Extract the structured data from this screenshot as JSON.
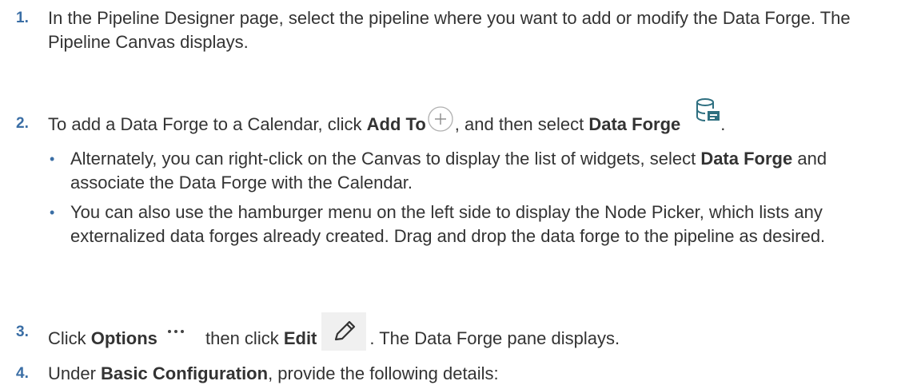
{
  "steps": [
    {
      "number": "1.",
      "text": "In the Pipeline Designer page, select the pipeline where you want to add or modify the Data Forge. The Pipeline Canvas displays."
    },
    {
      "number": "2.",
      "pre": "To add a Data Forge to a Calendar, click ",
      "bold1": "Add To",
      "mid": ", and then select ",
      "bold2": "Data Forge",
      "post": ".",
      "icons": [
        "add-to-plus-icon",
        "data-forge-database-icon"
      ],
      "bullets": [
        {
          "pre": "Alternately, you can right-click on the Canvas to display the list of widgets, select ",
          "bold": "Data Forge",
          "post": " and associate the Data Forge with the Calendar."
        },
        {
          "text": "You can also use the hamburger menu on the left side to display the Node Picker, which lists any externalized data forges already created. Drag and drop the data forge to the pipeline as desired."
        }
      ]
    },
    {
      "number": "3.",
      "pre": "Click ",
      "bold1": "Options",
      "mid": " then click ",
      "bold2": "Edit",
      "post": ". The Data Forge pane displays.",
      "icons": [
        "options-more-icon",
        "edit-pencil-icon"
      ]
    },
    {
      "number": "4.",
      "pre": "Under ",
      "bold1": "Basic Configuration",
      "post": ", provide the following details:"
    }
  ],
  "colors": {
    "text": "#333333",
    "accent": "#3a6ea5",
    "icon_gray": "#8a8a8a",
    "icon_teal": "#2e6f80"
  }
}
